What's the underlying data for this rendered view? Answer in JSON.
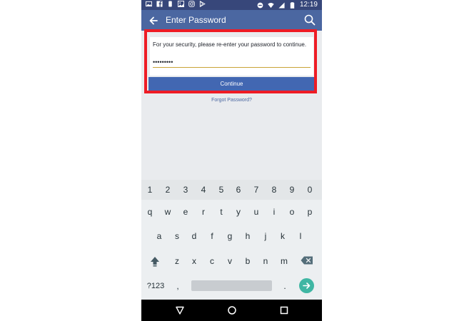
{
  "status_bar": {
    "time": "12:19"
  },
  "app_bar": {
    "title": "Enter Password"
  },
  "form": {
    "message": "For your security, please re-enter your password to continue.",
    "password_value": "•••••••••",
    "continue_label": "Continue",
    "forgot_label": "Forgot Password?"
  },
  "keyboard": {
    "row_numbers": [
      "1",
      "2",
      "3",
      "4",
      "5",
      "6",
      "7",
      "8",
      "9",
      "0"
    ],
    "row_top": [
      "q",
      "w",
      "e",
      "r",
      "t",
      "y",
      "u",
      "i",
      "o",
      "p"
    ],
    "row_mid": [
      "a",
      "s",
      "d",
      "f",
      "g",
      "h",
      "j",
      "k",
      "l"
    ],
    "row_bottom": [
      "z",
      "x",
      "c",
      "v",
      "b",
      "n",
      "m"
    ],
    "symbols_label": "?123",
    "comma_label": ",",
    "period_label": "."
  },
  "colors": {
    "status_bar": "#37477a",
    "app_bar": "#4b67a1",
    "continue_button": "#4267b2",
    "highlight_border": "#ee1c25",
    "enter_key": "#3fb6a3"
  }
}
